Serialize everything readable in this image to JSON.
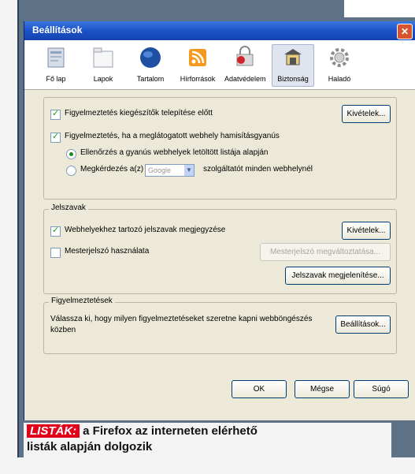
{
  "window": {
    "title": "Beállítások",
    "close_glyph": "✕"
  },
  "toolbar": {
    "tabs": [
      {
        "label": "Fő lap",
        "icon": "main-page-icon"
      },
      {
        "label": "Lapok",
        "icon": "tabs-icon"
      },
      {
        "label": "Tartalom",
        "icon": "content-globe-icon"
      },
      {
        "label": "Hírforrások",
        "icon": "feeds-icon"
      },
      {
        "label": "Adatvédelem",
        "icon": "privacy-icon"
      },
      {
        "label": "Biztonság",
        "icon": "security-icon",
        "active": true
      },
      {
        "label": "Haladó",
        "icon": "advanced-gear-icon"
      }
    ]
  },
  "security": {
    "warn_install_label": "Figyelmeztetés kiegészítők telepítése előtt",
    "warn_install_button": "Kivételek...",
    "warn_forgery_label": "Figyelmeztetés, ha a meglátogatott webhely hamisításgyanús",
    "radio_local_label": "Ellenőrzés a gyanús webhelyek letöltött listája alapján",
    "radio_ask_label": "Megkérdezés a(z)",
    "radio_ask_select": "Google",
    "radio_ask_suffix": "szolgáltatót minden webhelynél"
  },
  "passwords": {
    "title": "Jelszavak",
    "remember_label": "Webhelyekhez tartozó jelszavak megjegyzése",
    "remember_button": "Kivételek...",
    "master_label": "Mesterjelszó használata",
    "master_button": "Mesterjelszó megváltoztatása...",
    "show_button": "Jelszavak megjelenítése..."
  },
  "warnings": {
    "title": "Figyelmeztetések",
    "description_line1": "Válassza ki, hogy milyen figyelmeztetéseket szeretne kapni webböngészés",
    "description_line2": "közben",
    "settings_button": "Beállítások..."
  },
  "footer": {
    "ok": "OK",
    "cancel": "Mégse",
    "help": "Súgó"
  },
  "caption": {
    "keyword": "LISTÁK:",
    "line1": "a Firefox az interneten elérhető",
    "line2": "listák alapján dolgozik"
  },
  "colors": {
    "frame": "#5d7187",
    "window_bg": "#ece9d8",
    "titlebar": "#1d54c8",
    "caption_accent": "#e3001a"
  }
}
